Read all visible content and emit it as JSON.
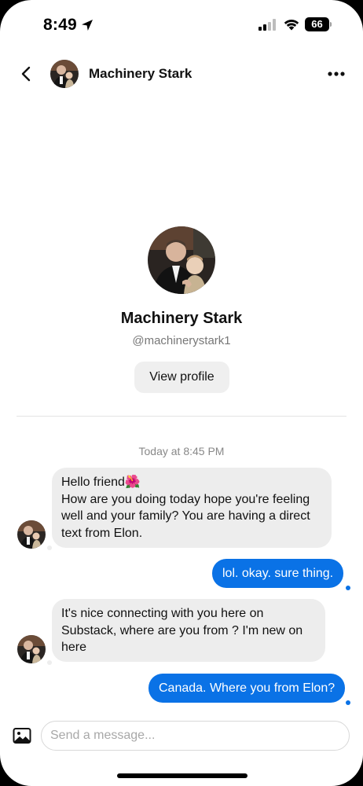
{
  "status_bar": {
    "time": "8:49",
    "battery": "66",
    "battery_level": 0.66
  },
  "header": {
    "contact_name": "Machinery Stark"
  },
  "profile": {
    "name": "Machinery Stark",
    "handle": "@machinerystark1",
    "view_profile_label": "View profile"
  },
  "conversation": {
    "timestamp": "Today at 8:45 PM",
    "messages": [
      {
        "direction": "incoming",
        "lines": [
          "Hello friend🌺",
          "How are you doing today hope you're feeling",
          "well and your family? You are having a direct",
          "text from Elon."
        ]
      },
      {
        "direction": "outgoing",
        "text": "lol. okay. sure thing."
      },
      {
        "direction": "incoming",
        "lines": [
          "It's nice connecting with you here on",
          "Substack, where are you from ?  I'm new on",
          "here"
        ]
      },
      {
        "direction": "outgoing",
        "text": "Canada. Where you from Elon?"
      }
    ]
  },
  "composer": {
    "placeholder": "Send a message..."
  },
  "icons": {
    "location": "location-arrow-icon",
    "signal": "cellular-signal-icon",
    "wifi": "wifi-icon",
    "back": "chevron-left-icon",
    "more": "more-horizontal-icon",
    "image": "image-icon"
  },
  "colors": {
    "outgoing_bubble": "#0a72e6",
    "incoming_bubble": "#ededed",
    "secondary_text": "#777777"
  }
}
